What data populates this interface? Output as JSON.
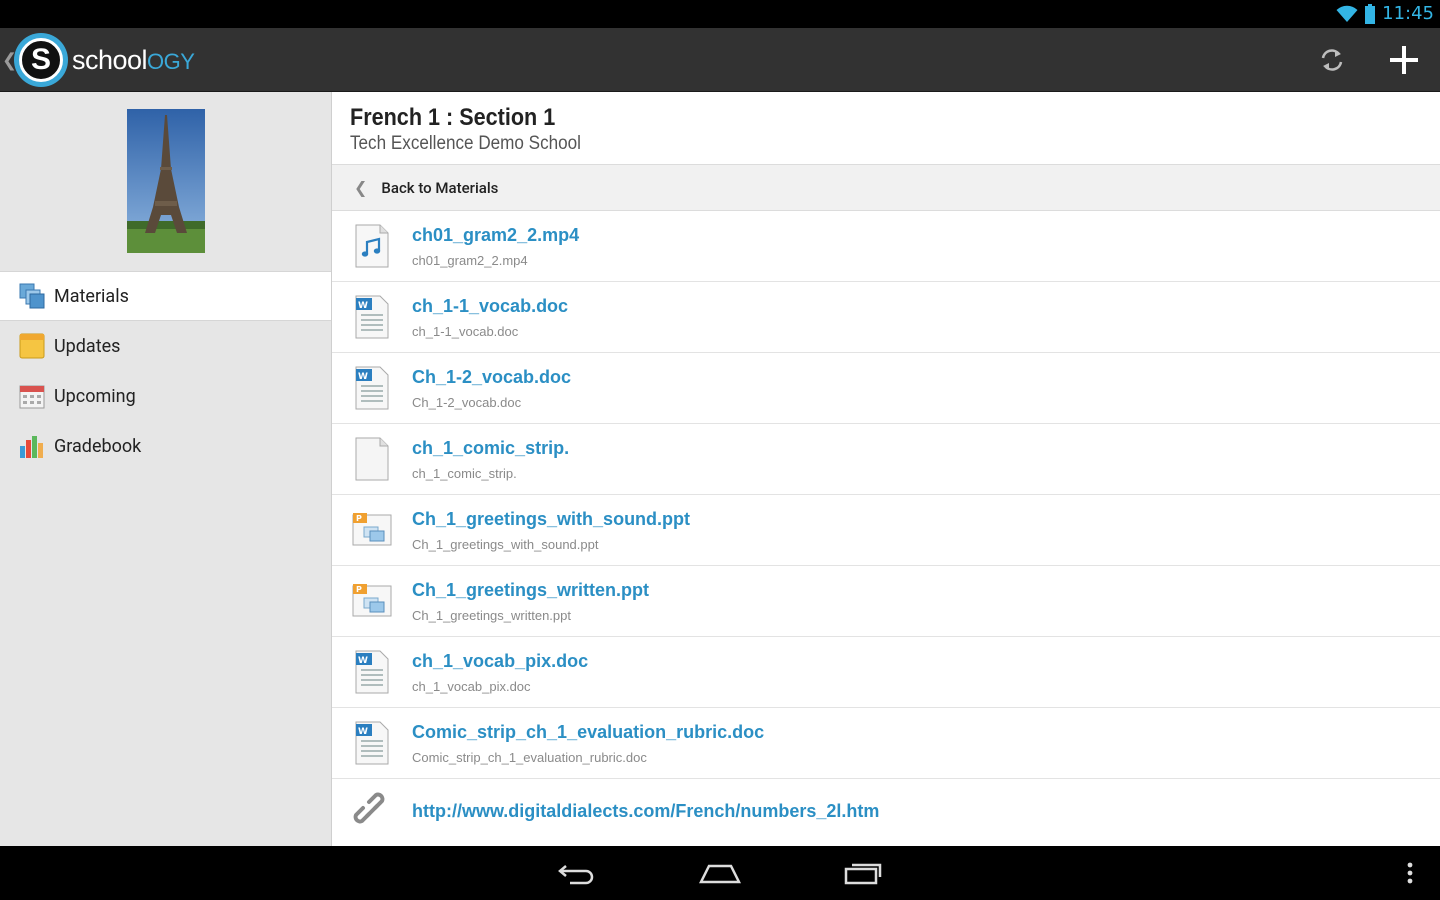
{
  "status_bar": {
    "time": "11:45",
    "wifi_icon": "wifi-icon",
    "battery_icon": "battery-icon"
  },
  "action_bar": {
    "brand_letter": "S",
    "brand_school": "school",
    "brand_ogy": "OGY",
    "refresh_icon": "refresh-icon",
    "add_icon": "add-icon"
  },
  "sidebar": {
    "items": [
      {
        "label": "Materials",
        "icon": "materials-icon",
        "active": true
      },
      {
        "label": "Updates",
        "icon": "updates-icon",
        "active": false
      },
      {
        "label": "Upcoming",
        "icon": "calendar-icon",
        "active": false
      },
      {
        "label": "Gradebook",
        "icon": "gradebook-icon",
        "active": false
      }
    ]
  },
  "course": {
    "title": "French 1  : Section 1",
    "school": "Tech Excellence Demo School"
  },
  "back": {
    "label": "Back to Materials"
  },
  "files": [
    {
      "name": "ch01_gram2_2.mp4",
      "sub": "ch01_gram2_2.mp4",
      "type": "audio"
    },
    {
      "name": "ch_1-1_vocab.doc",
      "sub": "ch_1-1_vocab.doc",
      "type": "word"
    },
    {
      "name": "Ch_1-2_vocab.doc",
      "sub": "Ch_1-2_vocab.doc",
      "type": "word"
    },
    {
      "name": "ch_1_comic_strip.",
      "sub": "ch_1_comic_strip.",
      "type": "blank"
    },
    {
      "name": "Ch_1_greetings_with_sound.ppt",
      "sub": "Ch_1_greetings_with_sound.ppt",
      "type": "ppt"
    },
    {
      "name": "Ch_1_greetings_written.ppt",
      "sub": "Ch_1_greetings_written.ppt",
      "type": "ppt"
    },
    {
      "name": "ch_1_vocab_pix.doc",
      "sub": "ch_1_vocab_pix.doc",
      "type": "word"
    },
    {
      "name": "Comic_strip_ch_1_evaluation_rubric.doc",
      "sub": "Comic_strip_ch_1_evaluation_rubric.doc",
      "type": "word"
    }
  ],
  "link_item": {
    "name": "http://www.digitaldialects.com/French/numbers_2l.htm",
    "type": "link"
  },
  "nav_bar": {
    "back": "back-icon",
    "home": "home-icon",
    "recents": "recents-icon",
    "menu": "overflow-menu-icon"
  },
  "colors": {
    "accent": "#2b8fc4",
    "brand": "#3aa8d8",
    "action_bar": "#323232",
    "sidebar": "#e6e6e6"
  }
}
